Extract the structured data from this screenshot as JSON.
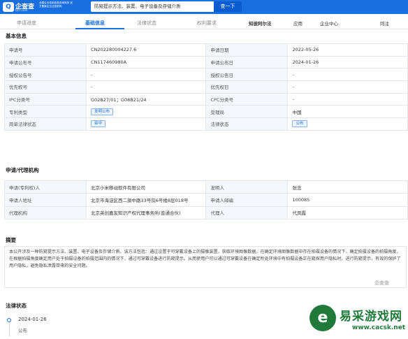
{
  "header": {
    "logo_text": "企查查",
    "logo_sub": "Qcc.com",
    "promo": "全国企业信用信息查询系统 官方备案企业征信机构",
    "search_value": "防窥提示方法、装置、电子设备及存储介质",
    "search_button": "查一下"
  },
  "tabs": [
    "申请进度",
    "基础信息",
    "法律状态",
    "权利要求"
  ],
  "right_tabs": {
    "brand": "知彼阿尔法",
    "apps": "应用",
    "enterprise": "企业中心",
    "user": "同注"
  },
  "basic_info": {
    "title": "基本信息",
    "rows": [
      [
        "申请号",
        "CN202280004227.6",
        "申请日期",
        "2022-05-26"
      ],
      [
        "申请公布号",
        "CN117460980A",
        "申请公布日",
        "2024-01-26"
      ],
      [
        "授权公告号",
        "-",
        "授权公告日",
        "-"
      ],
      [
        "优先权号",
        "-",
        "优先权日",
        "-"
      ],
      [
        "IPC分类号",
        "G02B27/01；G08B21/24",
        "CPC分类号",
        "-"
      ],
      [
        "专利类型",
        "发明公布",
        "受理局",
        "中国"
      ],
      [
        "简单法律状态",
        "审中",
        "法律状态",
        "公布"
      ]
    ]
  },
  "agency": {
    "title": "申请/代理机构",
    "rows": [
      [
        "申请(专利权)人",
        "北京小米移动软件有限公司",
        "发明人",
        "张念"
      ],
      [
        "申请人地址",
        "北京市海淀区西二旗中路33号院6号楼8层018号",
        "申请人邮编",
        "100085"
      ],
      [
        "代理机构",
        "北京英创嘉友知识产权代理事务所(普通合伙)",
        "代理人",
        "代凤霞"
      ]
    ]
  },
  "abstract": {
    "title": "摘要",
    "text": "本公开涉及一种防窥提示方法、装置、电子设备及存储介质，该方法包括：通过设置于可穿戴设备上的摄像装置，获取环境图像数据，在确定环境图像数据中存在拍摄设备的情况下，确定拍摄设备的拍摄角度，在根据拍摄角度确定用户处于拍摄设备的拍摄范围内的情况下，通过可穿戴设备进行防窥提示。从而使用户可以通过可穿戴设备在确定所处环境中有拍摄设备正在窥探用户隐私时，进行防窥提示，有效的保护了用户隐私，避免隐私泄露带来的安全问题。",
    "stamp": "企查查"
  },
  "legal": {
    "title": "法律状态",
    "events": [
      {
        "date": "2024-01-26",
        "event": "公布"
      }
    ]
  },
  "watermark": {
    "text": "易采游戏网",
    "url": "www.cacsk.net"
  }
}
